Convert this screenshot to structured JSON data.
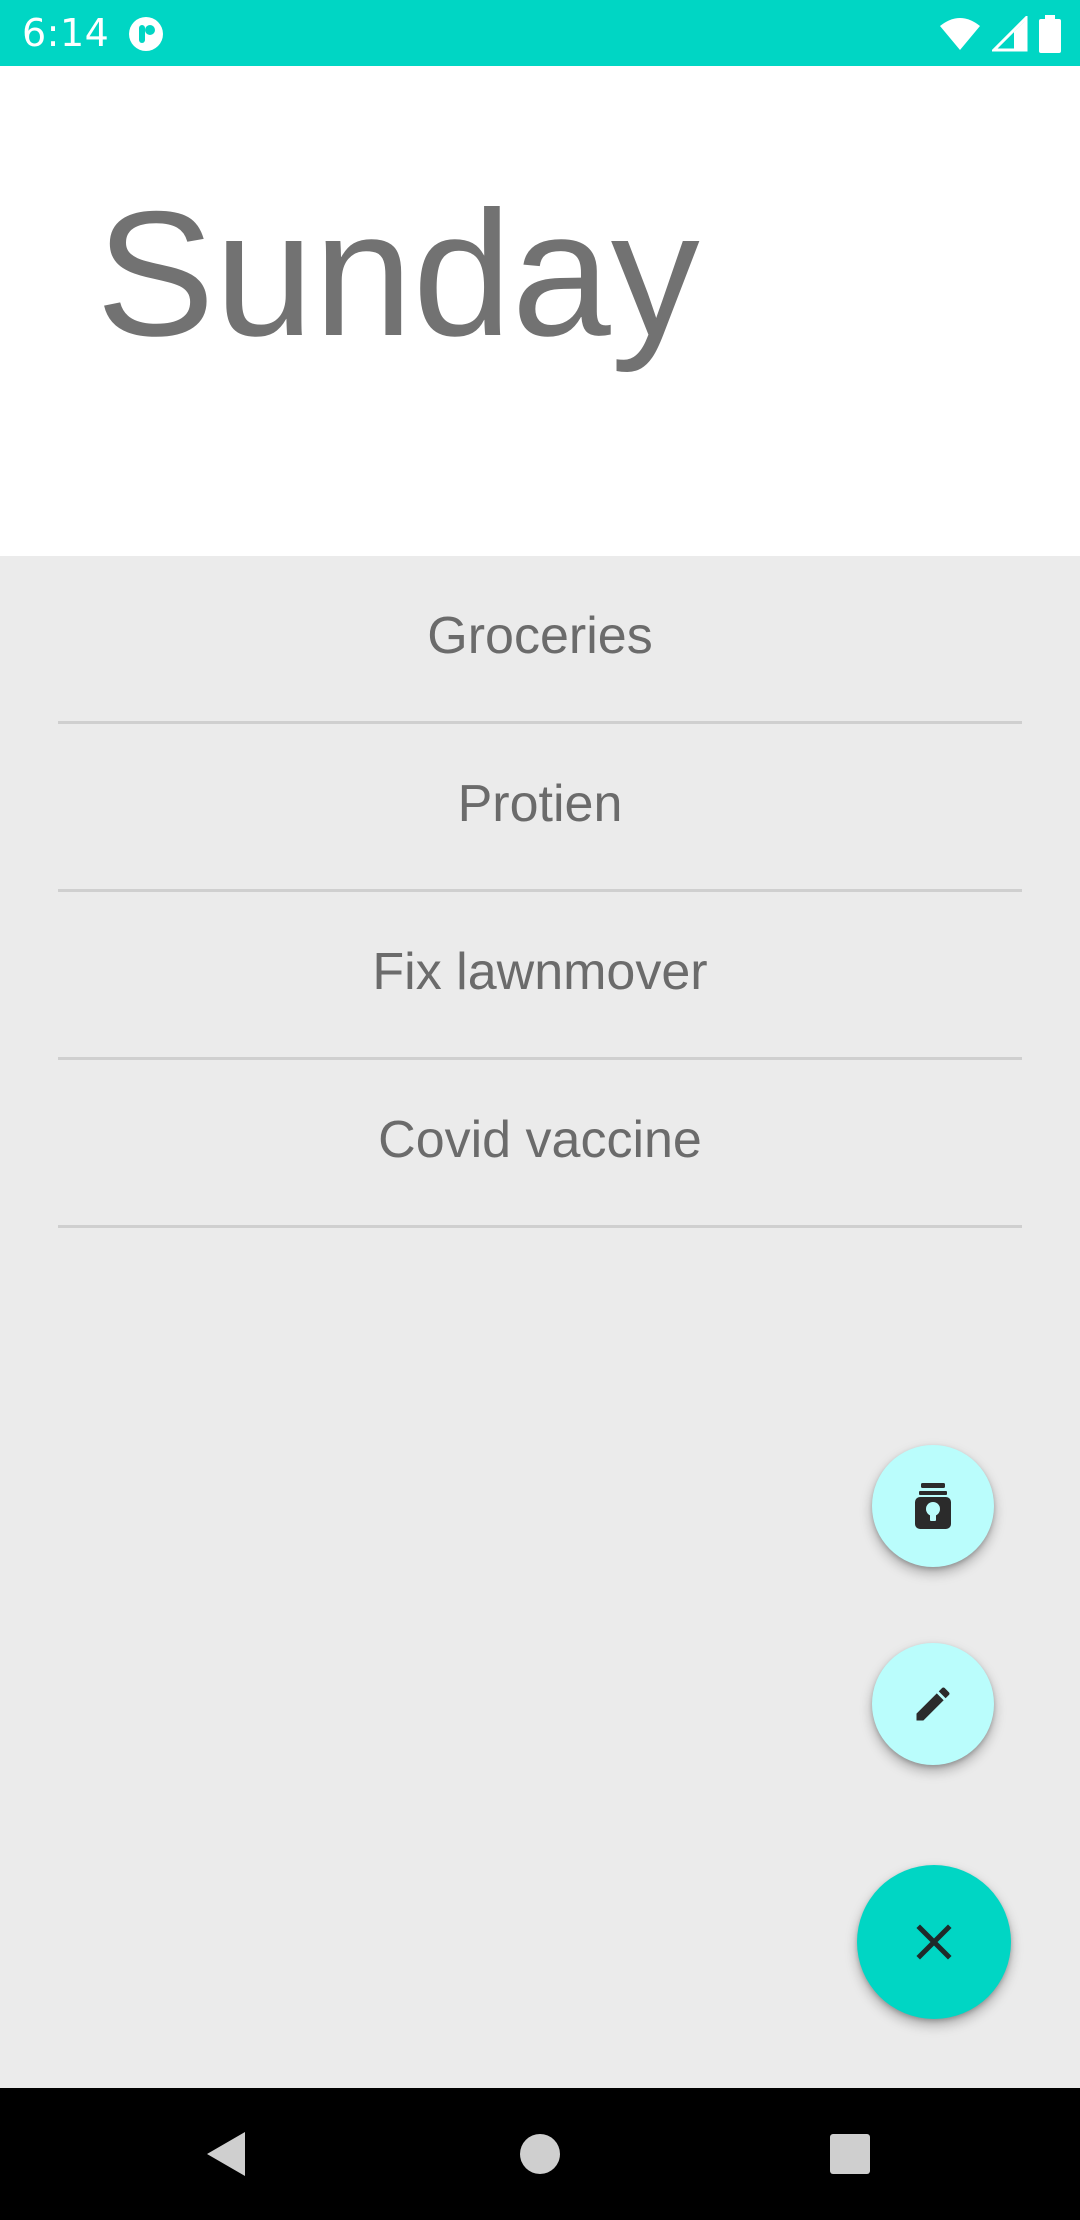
{
  "status_bar": {
    "time": "6:14",
    "background": "#00d6c4",
    "icons": [
      "app-notification-icon",
      "wifi-icon",
      "cellular-signal-icon",
      "battery-icon"
    ]
  },
  "header": {
    "title": "Sunday"
  },
  "tasks": [
    {
      "label": "Groceries"
    },
    {
      "label": "Protien"
    },
    {
      "label": "Fix lawnmover"
    },
    {
      "label": "Covid vaccine"
    }
  ],
  "fabs": {
    "ideas_icon": "lightbulb-jar-icon",
    "edit_icon": "pencil-icon",
    "close_icon": "close-icon",
    "mini_color": "#bafdfc",
    "main_color": "#00d6c4"
  },
  "nav_bar": {
    "buttons": [
      "back",
      "home",
      "recents"
    ]
  }
}
